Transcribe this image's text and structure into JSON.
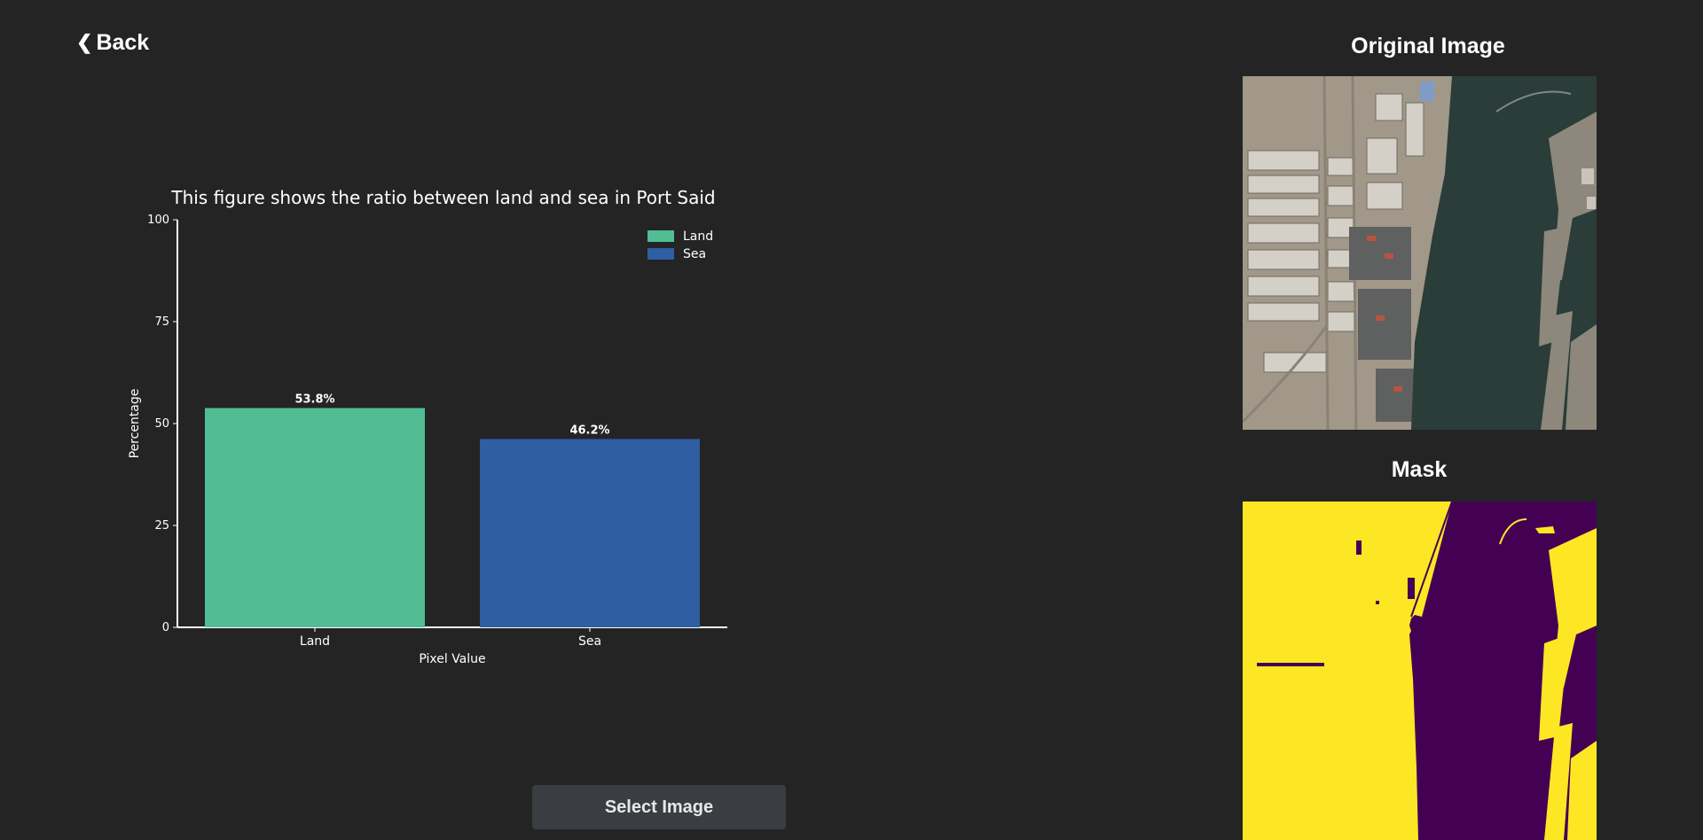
{
  "nav": {
    "back_icon": "chevron-left-icon",
    "back_label": "Back"
  },
  "chart_data": {
    "type": "bar",
    "title": "This figure shows the ratio between land and sea in Port Said",
    "xlabel": "Pixel Value",
    "ylabel": "Percentage",
    "categories": [
      "Land",
      "Sea"
    ],
    "values": [
      53.8,
      46.2
    ],
    "data_labels": [
      "53.8%",
      "46.2%"
    ],
    "colors": [
      "#52bd95",
      "#2f5ea3"
    ],
    "ylim": [
      0,
      100
    ],
    "yticks": [
      0,
      25,
      50,
      75,
      100
    ],
    "legend": {
      "placement": "top-right",
      "entries": [
        "Land",
        "Sea"
      ]
    },
    "grid": false
  },
  "actions": {
    "select_image_label": "Select Image"
  },
  "original": {
    "title": "Original Image"
  },
  "mask": {
    "title": "Mask",
    "colors": {
      "land": "#fde725",
      "sea": "#440154"
    }
  }
}
